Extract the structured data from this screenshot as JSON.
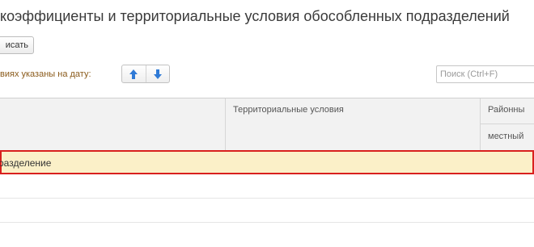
{
  "header": {
    "title": "коэффициенты и территориальные условия обособленных подразделений"
  },
  "toolbar": {
    "write_label": "исать"
  },
  "filter": {
    "date_label": "виях указаны на дату:",
    "up_icon": "arrow-up-icon",
    "down_icon": "arrow-down-icon"
  },
  "search": {
    "placeholder": "Поиск (Ctrl+F)",
    "value": ""
  },
  "table": {
    "columns": [
      {
        "label": ""
      },
      {
        "label": "Территориальные условия"
      },
      {
        "label": "Районны"
      }
    ],
    "subheader": "местный",
    "rows": [
      {
        "cells": [
          "разделение",
          "",
          ""
        ],
        "selected": true
      },
      {
        "cells": [
          "",
          "",
          ""
        ],
        "selected": false
      },
      {
        "cells": [
          "",
          "",
          ""
        ],
        "selected": false
      }
    ]
  },
  "colors": {
    "selection_border": "#d9201e",
    "selection_fill": "#fbf0c8",
    "accent": "#2f7ad6"
  }
}
